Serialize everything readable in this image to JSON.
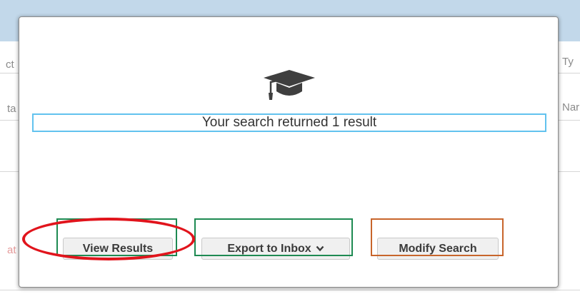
{
  "background": {
    "fragments": {
      "left_top": "ct",
      "left_mid": "ta",
      "left_bottom": "at",
      "right_top": "Ty",
      "right_mid": "Nar"
    }
  },
  "modal": {
    "icon": "graduation-cap-icon",
    "result_message": "Your search returned 1 result",
    "buttons": {
      "view_results": "View Results",
      "export_to_inbox": "Export to Inbox",
      "modify_search": "Modify Search"
    }
  },
  "colors": {
    "header_bg": "#c2d8ea",
    "result_border": "#62c2ee",
    "annotation_green": "#1e8a52",
    "annotation_orange": "#c8652b",
    "annotation_red": "#e1141c"
  }
}
